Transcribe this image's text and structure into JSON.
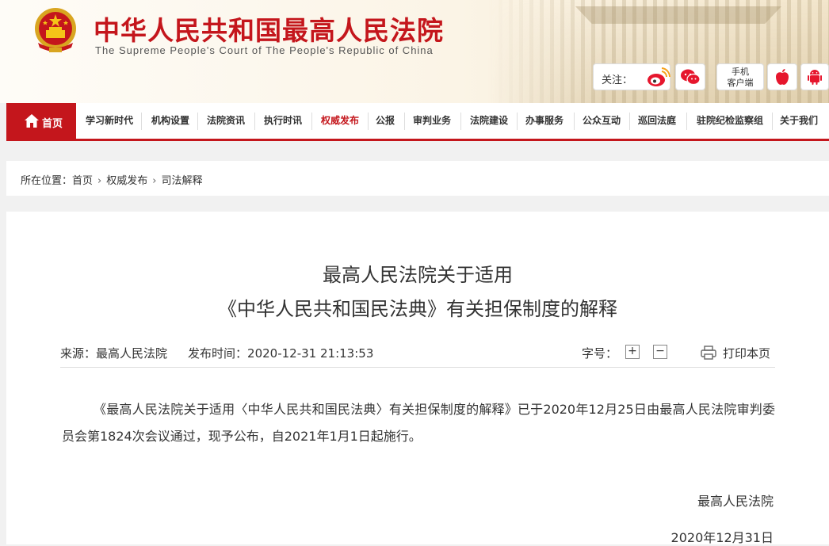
{
  "header": {
    "site_title": "中华人民共和国最高人民法院",
    "site_subtitle": "The Supreme People's Court of The People's Republic of China",
    "follow_label": "关注：",
    "mobile_line1": "手机",
    "mobile_line2": "客户端",
    "icons": [
      "national-emblem-icon",
      "weibo-icon",
      "wechat-icon",
      "apple-icon",
      "android-icon"
    ]
  },
  "nav": {
    "home": "首页",
    "items": [
      "学习新时代",
      "机构设置",
      "法院资讯",
      "执行时讯",
      "权威发布",
      "公报",
      "审判业务",
      "法院建设",
      "办事服务",
      "公众互动",
      "巡回法庭",
      "驻院纪检监察组",
      "关于我们"
    ],
    "active_index": 4
  },
  "breadcrumb": {
    "label": "所在位置：",
    "items": [
      "首页",
      "权威发布",
      "司法解释"
    ]
  },
  "article": {
    "title_line1": "最高人民法院关于适用",
    "title_line2": "《中华人民共和国民法典》有关担保制度的解释",
    "source_label": "来源：",
    "source": "最高人民法院",
    "time_label": "发布时间：",
    "time": "2020-12-31 21:13:53",
    "font_label": "字号：",
    "font_plus": "+",
    "font_minus": "−",
    "print_label": "打印本页",
    "body": "《最高人民法院关于适用〈中华人民共和国民法典〉有关担保制度的解释》已于2020年12月25日由最高人民法院审判委员会第1824次会议通过，现予公布，自2021年1月1日起施行。",
    "sign_org": "最高人民法院",
    "sign_date": "2020年12月31日"
  },
  "colors": {
    "brand_red": "#c4161c",
    "header_bg": "#fbf4e6"
  }
}
